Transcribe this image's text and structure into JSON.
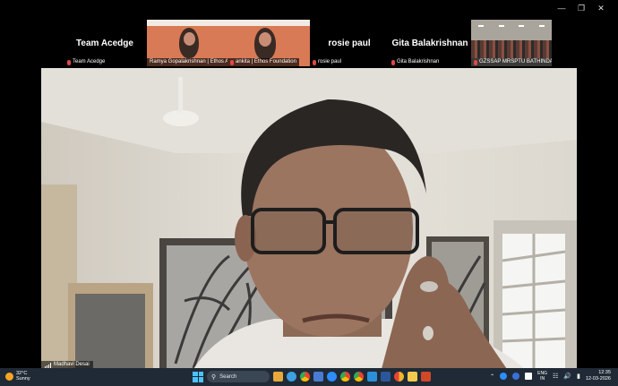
{
  "window": {
    "controls": [
      "minimize",
      "restore",
      "close"
    ]
  },
  "participants": [
    {
      "display_name": "Team Acedge",
      "label": "Team Acedge",
      "muted": true,
      "type": "name"
    },
    {
      "display_name": "",
      "label": "Ramya Gopalakrishnan | Ethos Arcau",
      "muted": false,
      "type": "video"
    },
    {
      "display_name": "",
      "label": "ankita | Ethos Foundation",
      "muted": true,
      "type": "video"
    },
    {
      "display_name": "rosie paul",
      "label": "rosie paul",
      "muted": true,
      "type": "name"
    },
    {
      "display_name": "Gita Balakrishnan",
      "label": "Gita Balakrishnan",
      "muted": true,
      "type": "name"
    },
    {
      "display_name": "",
      "label": "GZSSAP MRSPTU BATHINDA",
      "muted": true,
      "type": "video"
    }
  ],
  "speaker": {
    "label": "Madhavi Desai"
  },
  "taskbar": {
    "weather_temp": "32°C",
    "weather_desc": "Sunny",
    "search_placeholder": "Search",
    "lang_line1": "ENG",
    "lang_line2": "IN",
    "time": "12:35",
    "date": "12-03-2026",
    "pinned_icons": [
      "file-explorer-icon",
      "browser-icon",
      "chrome-icon",
      "store-icon",
      "zoom-icon",
      "chrome-profile-icon",
      "chrome-profile-icon-2",
      "photos-icon",
      "word-icon",
      "chrome-canary-icon",
      "files-icon",
      "powerpoint-icon"
    ]
  },
  "colors": {
    "accent": "#4cc2ff",
    "mic_off": "#e04848",
    "taskbar": "#1f2a36"
  }
}
